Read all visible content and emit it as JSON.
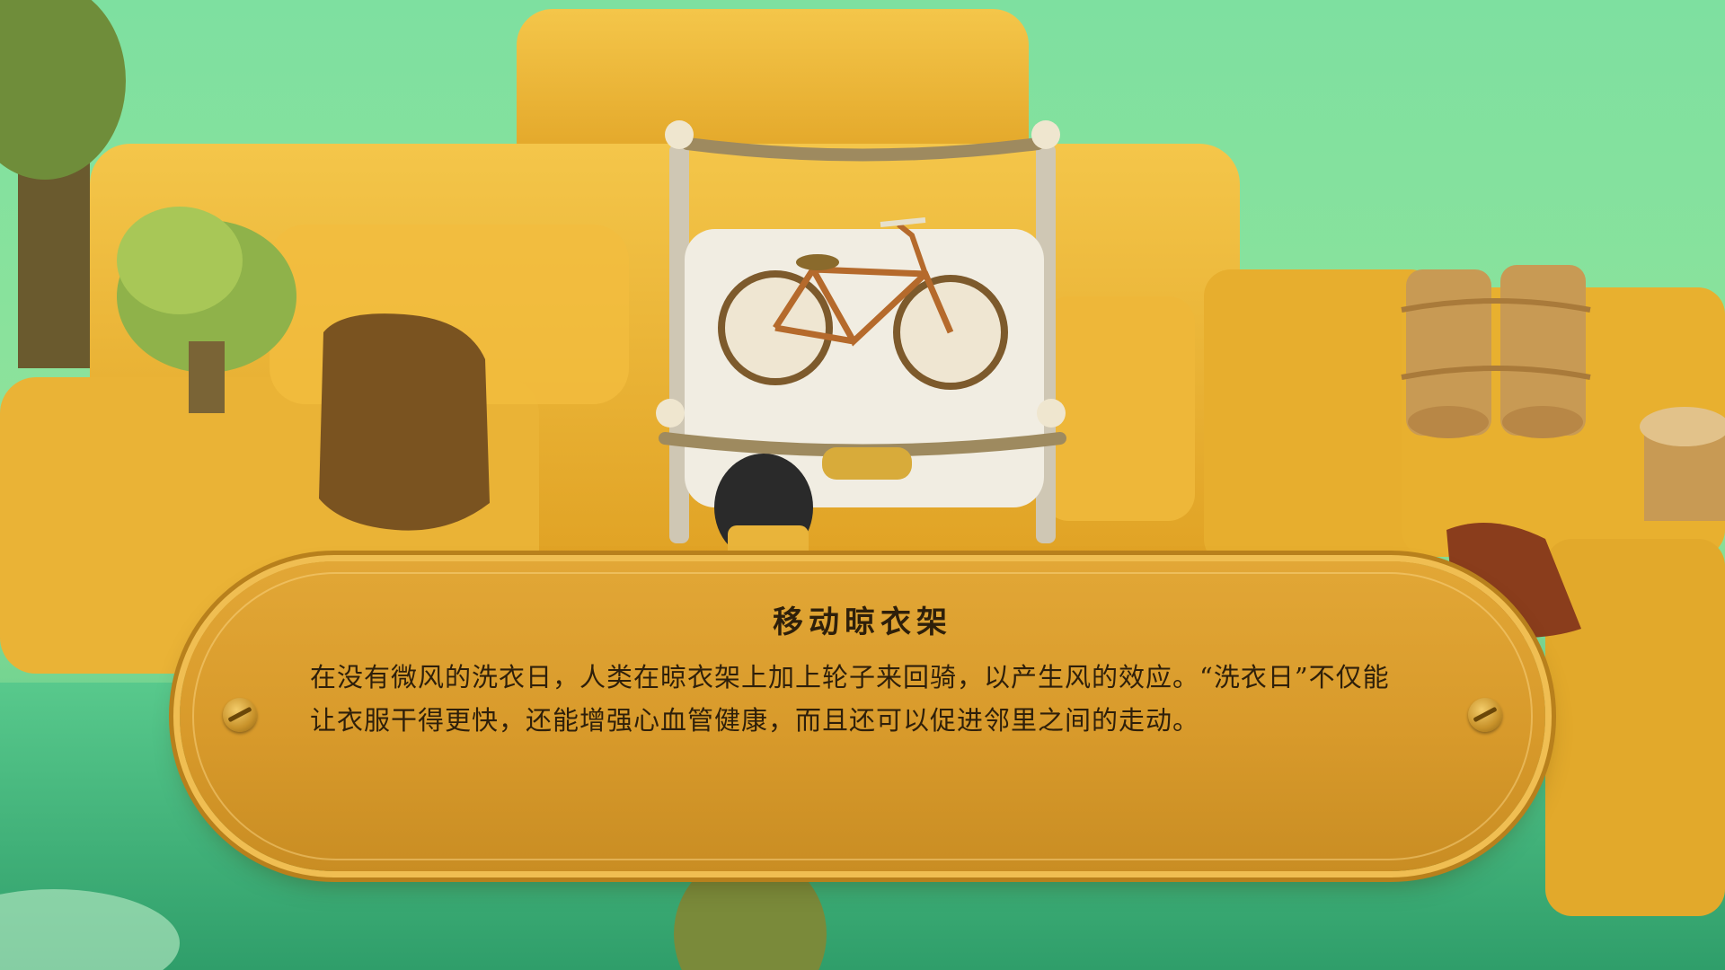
{
  "plaque": {
    "title": "移动晾衣架",
    "description": "在没有微风的洗衣日，人类在晾衣架上加上轮子来回骑，以产生风的效应。“洗衣日”不仅能让衣服干得更快，还能增强心血管健康，而且还可以促进邻里之间的走动。"
  },
  "colors": {
    "grass_gold": "#e8b330",
    "water_green": "#5cc98a",
    "plaque_gold": "#d89a2b",
    "text_dark": "#2e1f0a"
  },
  "icons": [
    "screw-icon",
    "bicycle-icon"
  ]
}
